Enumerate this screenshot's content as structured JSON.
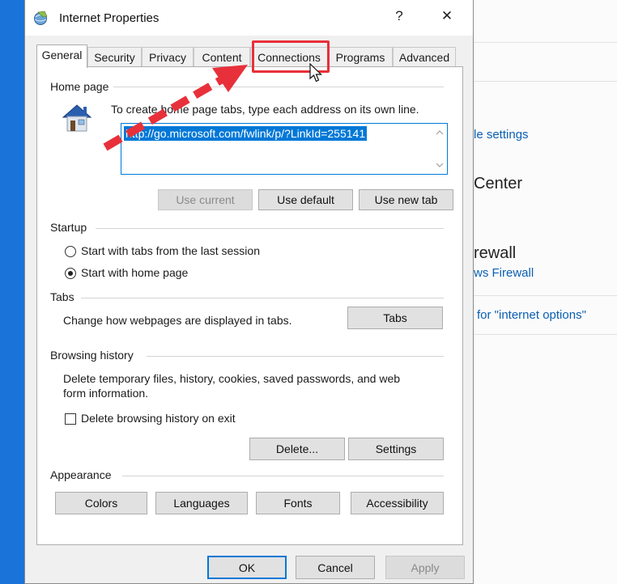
{
  "background_window": {
    "link1": "le settings",
    "heading1": "Center",
    "heading2": "rewall",
    "link2": "ws Firewall",
    "link3": "for \"internet options\""
  },
  "dialog": {
    "title": "Internet Properties",
    "help_label": "?",
    "close_label": "✕",
    "tabs": [
      "General",
      "Security",
      "Privacy",
      "Content",
      "Connections",
      "Programs",
      "Advanced"
    ],
    "active_tab": "General",
    "home_page": {
      "label": "Home page",
      "instruction": "To create home page tabs, type each address on its own line.",
      "value": "http://go.microsoft.com/fwlink/p/?LinkId=255141",
      "use_current": "Use current",
      "use_default": "Use default",
      "use_new_tab": "Use new tab"
    },
    "startup": {
      "label": "Startup",
      "option1": "Start with tabs from the last session",
      "option2": "Start with home page",
      "selected": "option2"
    },
    "tabs_section": {
      "label": "Tabs",
      "description": "Change how webpages are displayed in tabs.",
      "button": "Tabs"
    },
    "browsing_history": {
      "label": "Browsing history",
      "description_line1": "Delete temporary files, history, cookies, saved passwords, and web",
      "description_line2": "form information.",
      "checkbox_label": "Delete browsing history on exit",
      "checked": false,
      "delete_button": "Delete...",
      "settings_button": "Settings"
    },
    "appearance": {
      "label": "Appearance",
      "colors": "Colors",
      "languages": "Languages",
      "fonts": "Fonts",
      "accessibility": "Accessibility"
    },
    "footer": {
      "ok": "OK",
      "cancel": "Cancel",
      "apply": "Apply"
    }
  },
  "colors": {
    "desktop": "#1a73d9",
    "accent": "#0078d7",
    "annotation": "#e8303a"
  }
}
